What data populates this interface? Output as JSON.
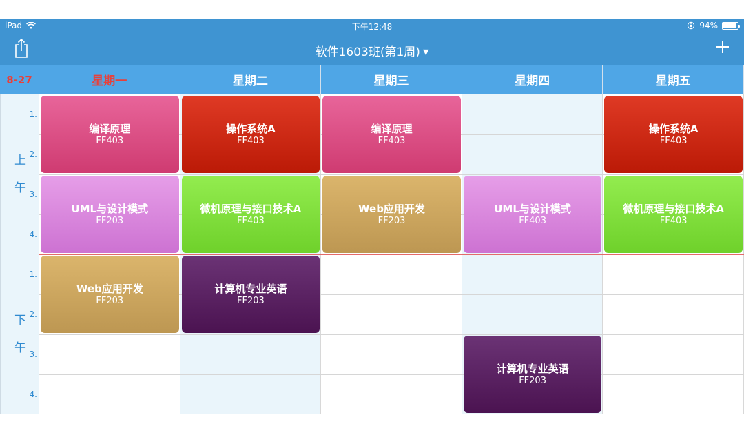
{
  "status_bar": {
    "device": "iPad",
    "time": "下午12:48",
    "battery": "94%",
    "battery_level": 0.94
  },
  "nav": {
    "title": "软件1603班(第1周)",
    "share_icon": "share-icon",
    "add_icon": "plus-icon"
  },
  "header": {
    "date": "8-27",
    "days": [
      "星期一",
      "星期二",
      "星期三",
      "星期四",
      "星期五"
    ],
    "today_index": 0
  },
  "time_column": {
    "morning": [
      "上",
      "午"
    ],
    "afternoon": [
      "下",
      "午"
    ],
    "periods": [
      "1.",
      "2.",
      "3.",
      "4.",
      "1.",
      "2.",
      "3.",
      "4."
    ]
  },
  "courses": [
    {
      "day": 0,
      "start": 1,
      "span": 2,
      "name": "编译原理",
      "room": "FF403",
      "color": "pink"
    },
    {
      "day": 1,
      "start": 1,
      "span": 2,
      "name": "操作系统A",
      "room": "FF403",
      "color": "red"
    },
    {
      "day": 2,
      "start": 1,
      "span": 2,
      "name": "编译原理",
      "room": "FF403",
      "color": "pink"
    },
    {
      "day": 4,
      "start": 1,
      "span": 2,
      "name": "操作系统A",
      "room": "FF403",
      "color": "red"
    },
    {
      "day": 0,
      "start": 3,
      "span": 2,
      "name": "UML与设计模式",
      "room": "FF203",
      "color": "violet"
    },
    {
      "day": 1,
      "start": 3,
      "span": 2,
      "name": "微机原理与接口技术A",
      "room": "FF403",
      "color": "green"
    },
    {
      "day": 2,
      "start": 3,
      "span": 2,
      "name": "Web应用开发",
      "room": "FF203",
      "color": "tan"
    },
    {
      "day": 3,
      "start": 3,
      "span": 2,
      "name": "UML与设计模式",
      "room": "FF403",
      "color": "violet"
    },
    {
      "day": 4,
      "start": 3,
      "span": 2,
      "name": "微机原理与接口技术A",
      "room": "FF403",
      "color": "green"
    },
    {
      "day": 0,
      "start": 5,
      "span": 2,
      "name": "Web应用开发",
      "room": "FF203",
      "color": "tan"
    },
    {
      "day": 1,
      "start": 5,
      "span": 2,
      "name": "计算机专业英语",
      "room": "FF203",
      "color": "purple"
    },
    {
      "day": 3,
      "start": 7,
      "span": 2,
      "name": "计算机专业英语",
      "room": "FF203",
      "color": "purple"
    }
  ]
}
